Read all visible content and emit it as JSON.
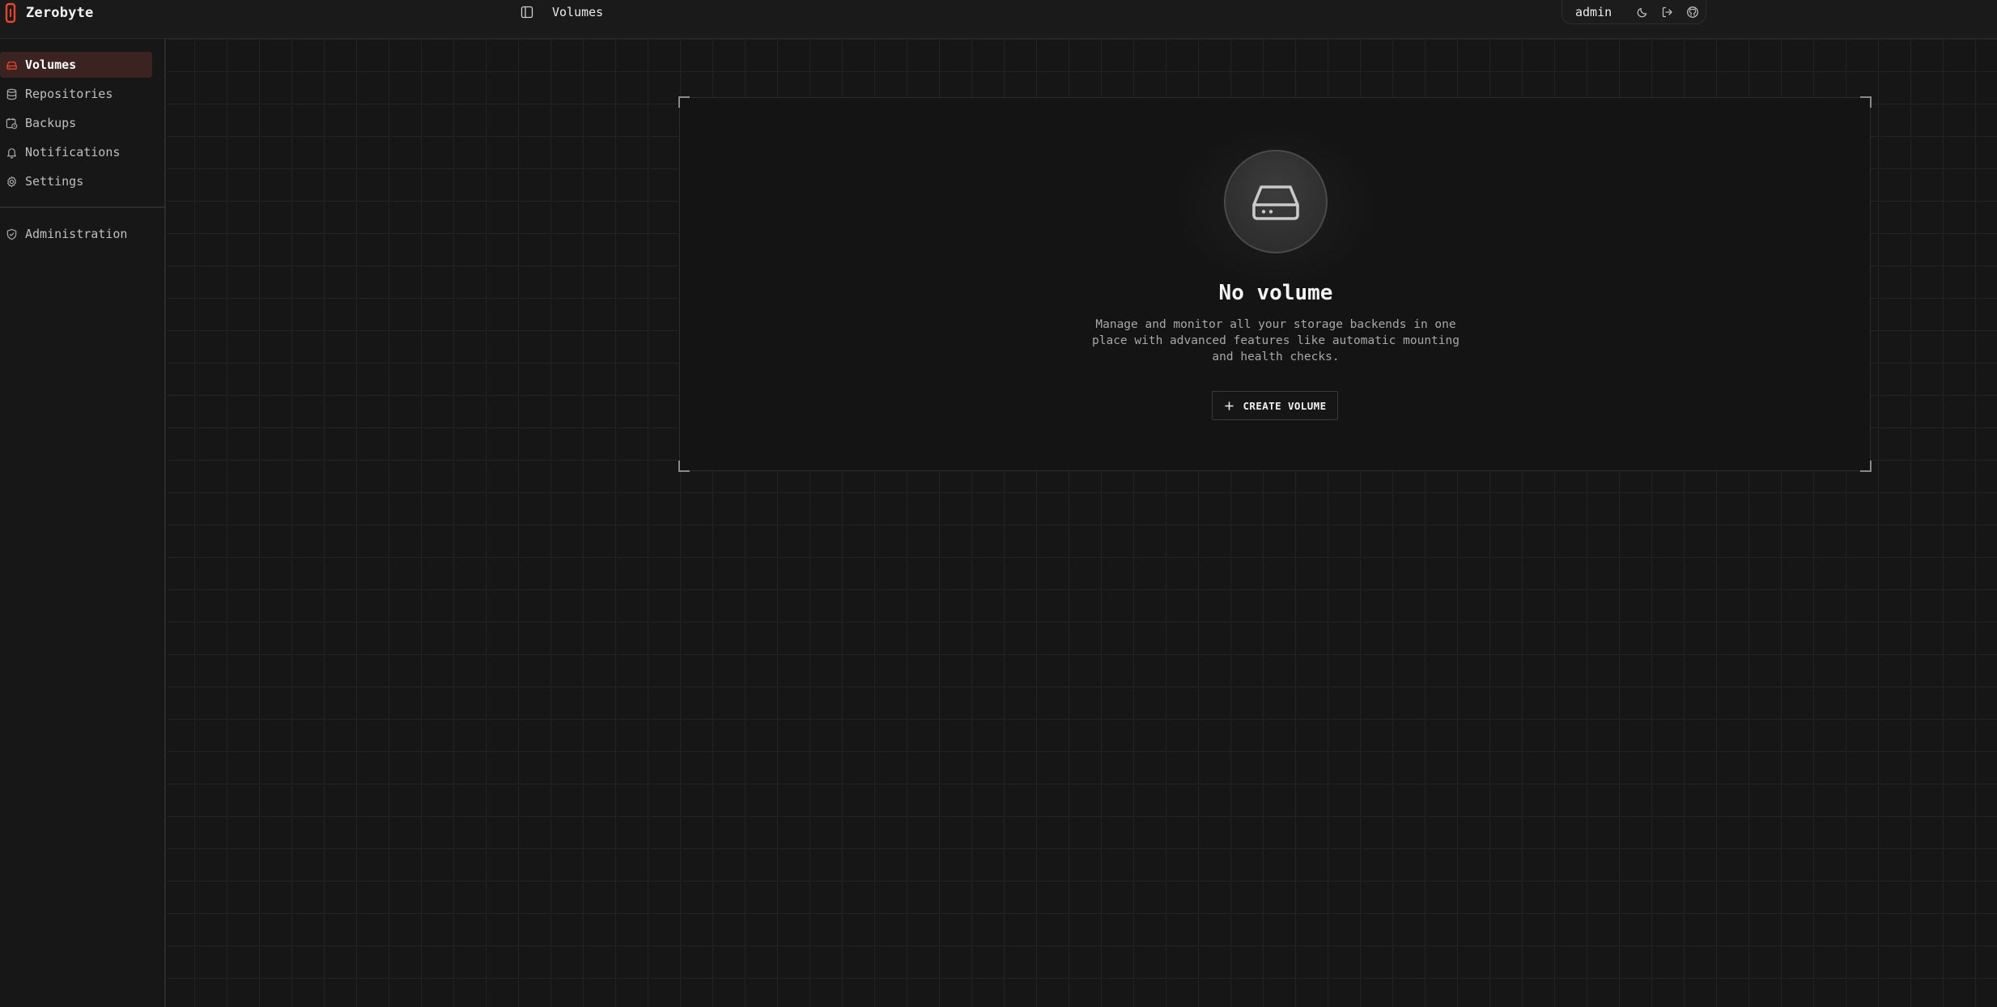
{
  "app": {
    "name": "Zerobyte",
    "accent": "#e8452c"
  },
  "header": {
    "page_title": "Volumes",
    "user": "admin"
  },
  "sidebar": {
    "items": [
      {
        "label": "Volumes",
        "icon": "hard-drive-icon",
        "active": true
      },
      {
        "label": "Repositories",
        "icon": "database-icon",
        "active": false
      },
      {
        "label": "Backups",
        "icon": "calendar-clock-icon",
        "active": false
      },
      {
        "label": "Notifications",
        "icon": "bell-icon",
        "active": false
      },
      {
        "label": "Settings",
        "icon": "gear-icon",
        "active": false
      },
      {
        "label": "Administration",
        "icon": "shield-check-icon",
        "active": false
      }
    ]
  },
  "empty_state": {
    "title": "No volume",
    "description": "Manage and monitor all your storage backends in one place with advanced features like automatic mounting and health checks.",
    "button_label": "CREATE VOLUME"
  }
}
